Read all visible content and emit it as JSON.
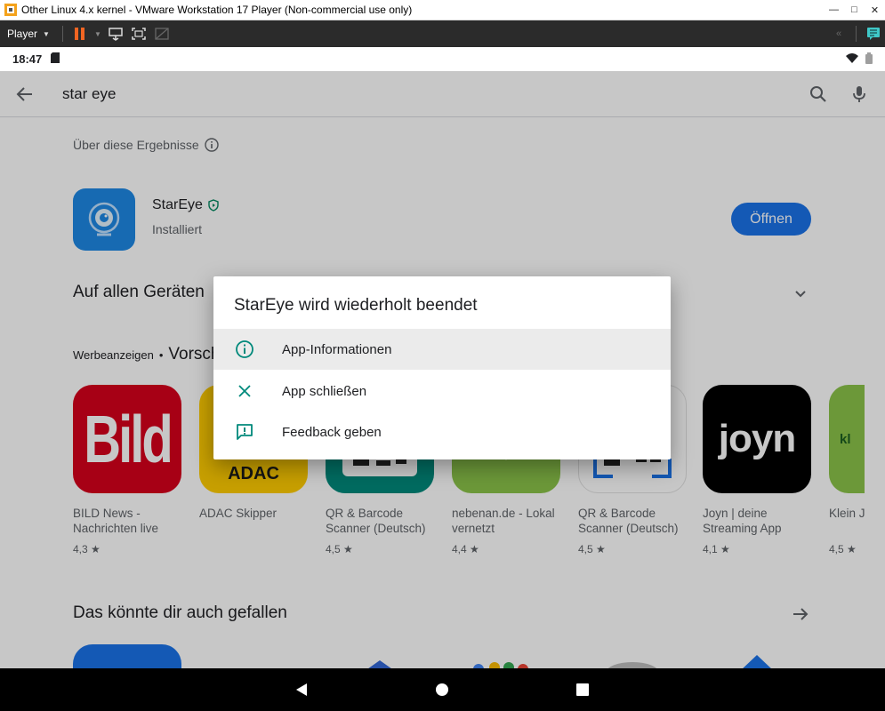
{
  "window": {
    "title": "Other Linux 4.x kernel - VMware Workstation 17 Player (Non-commercial use only)",
    "player_menu": "Player"
  },
  "statusbar": {
    "time": "18:47"
  },
  "search": {
    "query": "star eye"
  },
  "about_results": "Über diese Ergebnisse",
  "app": {
    "name": "StarEye",
    "status": "Installiert",
    "open_button": "Öffnen"
  },
  "sections": {
    "all_devices": "Auf allen Geräten",
    "ads_label": "Werbeanzeigen",
    "ads_separator": "•",
    "ads_title": "Vorschläge für dich",
    "you_might_like": "Das könnte dir auch gefallen"
  },
  "cards": [
    {
      "name": "BILD News - Nachrichten live",
      "rating": "4,3 ★",
      "icon_color": "#d6001c",
      "icon": "bild-logo"
    },
    {
      "name": "ADAC Skipper",
      "rating": "",
      "icon_color": "#ffcc00",
      "icon": "adac-logo"
    },
    {
      "name": "QR & Barcode Scanner (Deutsch)",
      "rating": "4,5 ★",
      "icon_color": "#00897b",
      "icon": "qr-icon"
    },
    {
      "name": "nebenan.de - Lokal vernetzt",
      "rating": "4,4 ★",
      "icon_color": "#8bc34a",
      "icon": "nebenan-logo"
    },
    {
      "name": "QR & Barcode Scanner (Deutsch)",
      "rating": "4,5 ★",
      "icon_color": "#ffffff",
      "icon": "qr-scanner-icon"
    },
    {
      "name": "Joyn | deine Streaming App",
      "rating": "4,1 ★",
      "icon_color": "#000000",
      "icon": "joyn-logo"
    },
    {
      "name": "Klein Jetzt",
      "rating": "4,5 ★",
      "icon_color": "#8bc34a",
      "icon": "kl-logo"
    }
  ],
  "dialog": {
    "title": "StarEye wird wiederholt beendet",
    "items": [
      {
        "label": "App-Informationen",
        "icon": "info-icon"
      },
      {
        "label": "App schließen",
        "icon": "close-icon"
      },
      {
        "label": "Feedback geben",
        "icon": "feedback-icon"
      }
    ],
    "accent": "#00897b"
  },
  "joyn_text": "joyn",
  "bild_text": "Bild",
  "adac_text": "ADAC",
  "kl_text": "kl"
}
